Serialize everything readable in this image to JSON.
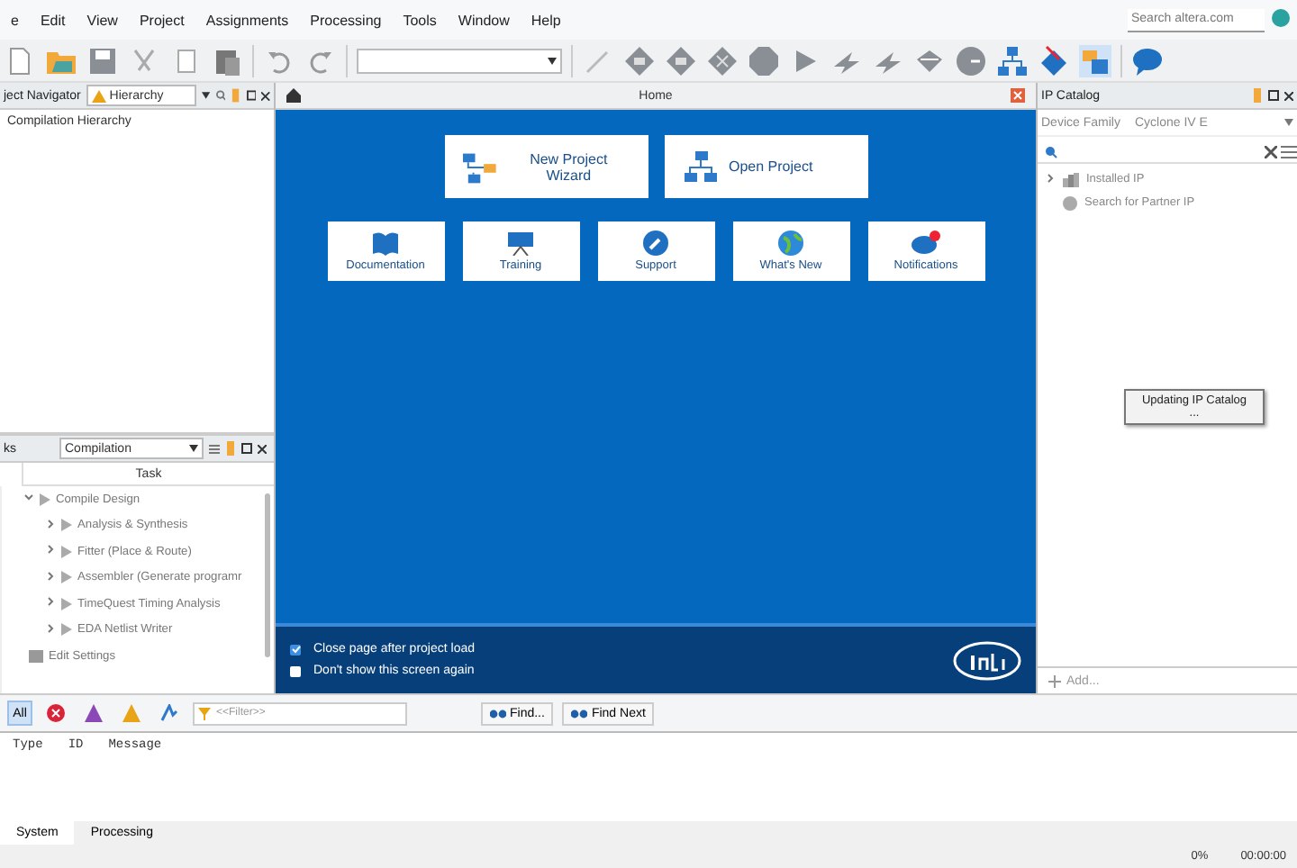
{
  "menu": [
    "e",
    "Edit",
    "View",
    "Project",
    "Assignments",
    "Processing",
    "Tools",
    "Window",
    "Help"
  ],
  "search": {
    "placeholder": "Search altera.com"
  },
  "navigator": {
    "title": "ject Navigator",
    "view": "Hierarchy",
    "items": [
      "Compilation Hierarchy"
    ]
  },
  "tasks": {
    "title": "ks",
    "flow": "Compilation",
    "column": "Task",
    "items": [
      {
        "label": "Compile Design",
        "kind": "task",
        "expanded": true,
        "children": [
          {
            "label": "Analysis & Synthesis",
            "kind": "task",
            "expanded": false
          },
          {
            "label": "Fitter (Place & Route)",
            "kind": "task",
            "expanded": false
          },
          {
            "label": "Assembler (Generate programr",
            "kind": "task",
            "expanded": false
          },
          {
            "label": "TimeQuest Timing Analysis",
            "kind": "task",
            "expanded": false
          },
          {
            "label": "EDA Netlist Writer",
            "kind": "task",
            "expanded": false
          }
        ]
      },
      {
        "label": "Edit Settings",
        "kind": "settings"
      }
    ]
  },
  "home": {
    "tab": "Home",
    "actions": [
      {
        "label": "New Project Wizard",
        "kind": "wizard"
      },
      {
        "label": "Open Project",
        "kind": "open"
      }
    ],
    "links": [
      {
        "label": "Documentation",
        "kind": "book"
      },
      {
        "label": "Training",
        "kind": "training"
      },
      {
        "label": "Support",
        "kind": "support"
      },
      {
        "label": "What's New",
        "kind": "globe"
      },
      {
        "label": "Notifications",
        "kind": "chat"
      }
    ],
    "options": [
      {
        "label": "Close page after project load",
        "checked": true
      },
      {
        "label": "Don't show this screen again",
        "checked": false
      }
    ]
  },
  "ip_catalog": {
    "title": "IP Catalog",
    "family_label": "Device Family",
    "family": "Cyclone IV E",
    "items": [
      {
        "label": "Installed IP",
        "kind": "library",
        "expanded": false
      },
      {
        "label": "Search for Partner IP",
        "kind": "partner"
      }
    ],
    "status": "Updating IP Catalog ...",
    "add": "Add..."
  },
  "messages": {
    "filters": [
      {
        "kind": "all",
        "label": "All",
        "selected": true
      },
      {
        "kind": "error",
        "selected": false
      },
      {
        "kind": "critical",
        "selected": false
      },
      {
        "kind": "warning",
        "selected": false
      },
      {
        "kind": "suppressed",
        "selected": false
      }
    ],
    "filter_placeholder": "<<Filter>>",
    "find": "Find...",
    "find_next": "Find Next",
    "columns": [
      "Type",
      "ID",
      "Message"
    ],
    "tabs": [
      {
        "label": "System",
        "selected": true
      },
      {
        "label": "Processing",
        "selected": false
      }
    ]
  },
  "status_bar": {
    "progress": "0%",
    "time": "00:00:00"
  }
}
